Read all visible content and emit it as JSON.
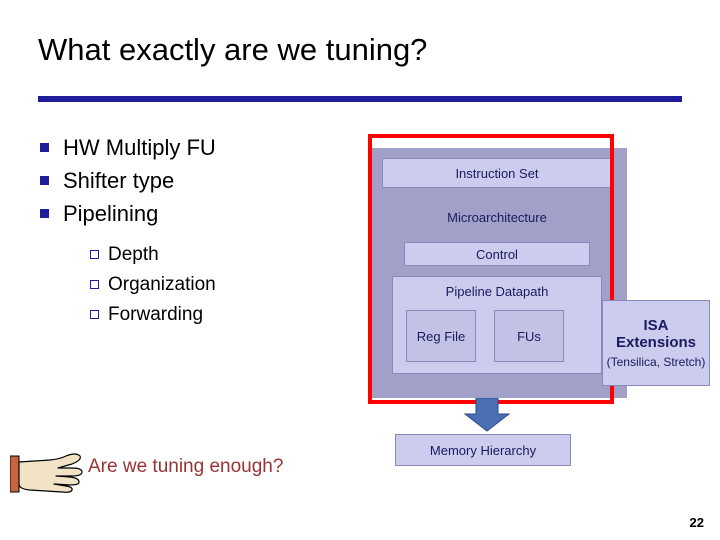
{
  "slide": {
    "title": "What exactly are we tuning?",
    "page_number": "22",
    "accent_color": "#1f1f9c",
    "highlight_color": "#ff0000",
    "question_color": "#993333"
  },
  "bullets": [
    {
      "label": "HW Multiply FU"
    },
    {
      "label": "Shifter type"
    },
    {
      "label": "Pipelining"
    }
  ],
  "sub_bullets": [
    {
      "label": "Depth"
    },
    {
      "label": "Organization"
    },
    {
      "label": "Forwarding"
    }
  ],
  "diagram": {
    "instruction_set": "Instruction Set",
    "microarchitecture": "Microarchitecture",
    "control": "Control",
    "pipeline_datapath": "Pipeline Datapath",
    "reg_file": "Reg File",
    "fus": "FUs",
    "memory_hierarchy": "Memory Hierarchy",
    "isa_extensions_title": "ISA Extensions",
    "isa_extensions_sub": "(Tensilica, Stretch)"
  },
  "footer": {
    "question": "Are we tuning enough?"
  }
}
